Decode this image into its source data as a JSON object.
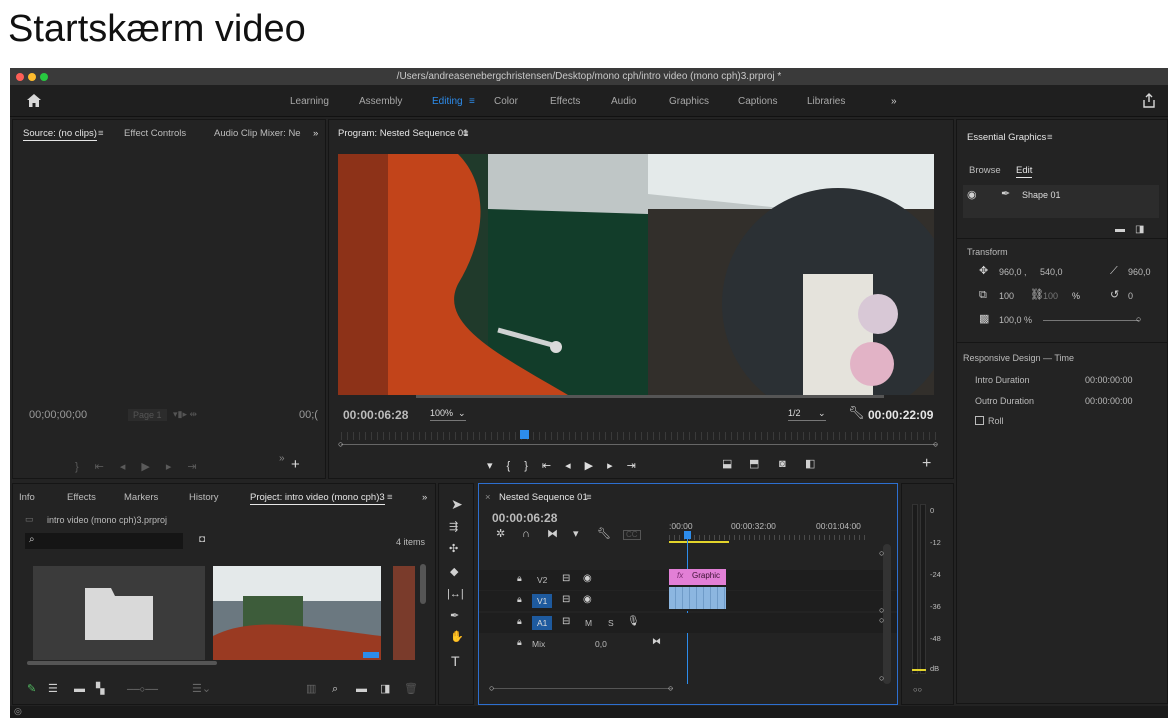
{
  "page_heading": "Startskærm video",
  "window": {
    "path_title": "/Users/andreasenebergchristensen/Desktop/mono cph/intro video (mono cph)3.prproj *"
  },
  "workspaces": [
    "Learning",
    "Assembly",
    "Editing",
    "Color",
    "Effects",
    "Audio",
    "Graphics",
    "Captions",
    "Libraries"
  ],
  "workspaces_more": "»",
  "source_panel": {
    "tabs": [
      "Source: (no clips)",
      "Effect Controls",
      "Audio Clip Mixer: Ne"
    ],
    "more": "»",
    "timecode_left": "00;00;00;00",
    "page_label": "Page 1",
    "timecode_right": "00;("
  },
  "program_panel": {
    "title": "Program: Nested Sequence 01",
    "current_time": "00:00:06:28",
    "zoom": "100%",
    "resolution": "1/2",
    "duration": "00:00:22:09"
  },
  "essential_graphics": {
    "title": "Essential Graphics",
    "tabs": [
      "Browse",
      "Edit"
    ],
    "layer_name": "Shape 01",
    "transform_label": "Transform",
    "position_x": "960,0 ,",
    "position_y": "540,0",
    "anchor": "960,0",
    "scale": "100",
    "scale_linked": "100",
    "percent_sign": "%",
    "rotation": "0",
    "opacity": "100,0 %",
    "responsive_label": "Responsive Design — Time",
    "intro_label": "Intro Duration",
    "intro_value": "00:00:00:00",
    "outro_label": "Outro Duration",
    "outro_value": "00:00:00:00",
    "roll_label": "Roll"
  },
  "project_panel": {
    "tabs": [
      "Info",
      "Effects",
      "Markers",
      "History",
      "Project: intro video (mono cph)3"
    ],
    "more": "»",
    "file_name": "intro video (mono cph)3.prproj",
    "item_count": "4 items"
  },
  "timeline": {
    "title": "Nested Sequence 01",
    "current_time": "00:00:06:28",
    "ruler": [
      ":00:00",
      "00:00:32:00",
      "00:01:04:00"
    ],
    "tracks": [
      {
        "name": "V2"
      },
      {
        "name": "V1"
      },
      {
        "name": "A1",
        "m": "M",
        "s": "S"
      }
    ],
    "mix_label": "Mix",
    "mix_value": "0,0",
    "clip_graphic": "Graphic",
    "clip_fx": "fx"
  },
  "meter": {
    "scale": [
      "0",
      "-12",
      "-24",
      "-36",
      "-48",
      "dB"
    ],
    "solo": "S",
    "bottom": "○○"
  }
}
